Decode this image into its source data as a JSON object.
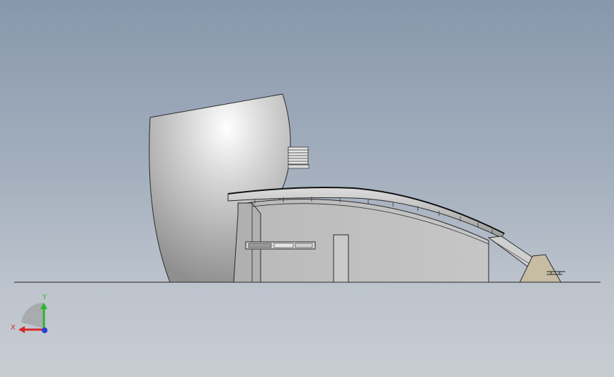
{
  "viewport": {
    "background_top": "#8797ab",
    "background_bottom": "#c8cdd3"
  },
  "model": {
    "tower_color": "#c8c8c8",
    "building_color": "#c0c0c0",
    "roof_color": "#a8a8a8",
    "ramp_base_color": "#c7bca4",
    "edge_color": "#2a2a2a"
  },
  "triad": {
    "x_label": "X",
    "y_label": "Y",
    "x_color": "#d62a2a",
    "y_color": "#2fb52f",
    "z_color": "#2a3fd6"
  }
}
